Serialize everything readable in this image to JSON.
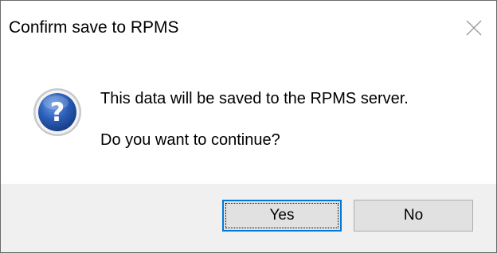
{
  "window": {
    "title": "Confirm save to RPMS"
  },
  "icons": {
    "close": "close-icon",
    "message": "question-icon"
  },
  "message": {
    "line1": "This data will be saved to the RPMS server.",
    "line2": "Do you want to continue?"
  },
  "buttons": {
    "yes_label": "Yes",
    "no_label": "No",
    "default": "Yes"
  },
  "colors": {
    "footer_bg": "#f0f0f0",
    "button_bg": "#e1e1e1",
    "default_button_border": "#0078d7",
    "icon_blue": "#1f4fa3"
  }
}
